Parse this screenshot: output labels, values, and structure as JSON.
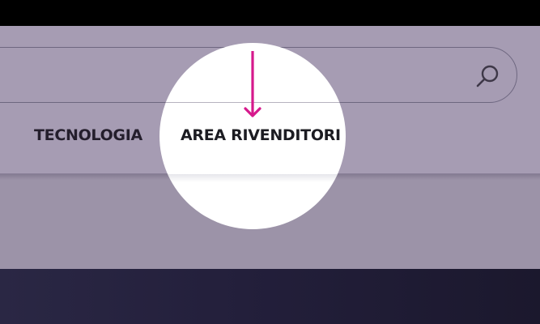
{
  "nav": {
    "items": [
      {
        "label": "TECNOLOGIA"
      },
      {
        "label": "AREA RIVENDITORI"
      }
    ]
  },
  "search": {
    "icon": "search-icon"
  },
  "highlight": {
    "arrow_icon": "arrow-down-icon",
    "arrow_color": "#d6198c"
  },
  "colors": {
    "header_overlay": "#a69cb3",
    "content_overlay": "#9c93a8",
    "footer": "#231f3b",
    "nav_text": "#241e2c"
  }
}
